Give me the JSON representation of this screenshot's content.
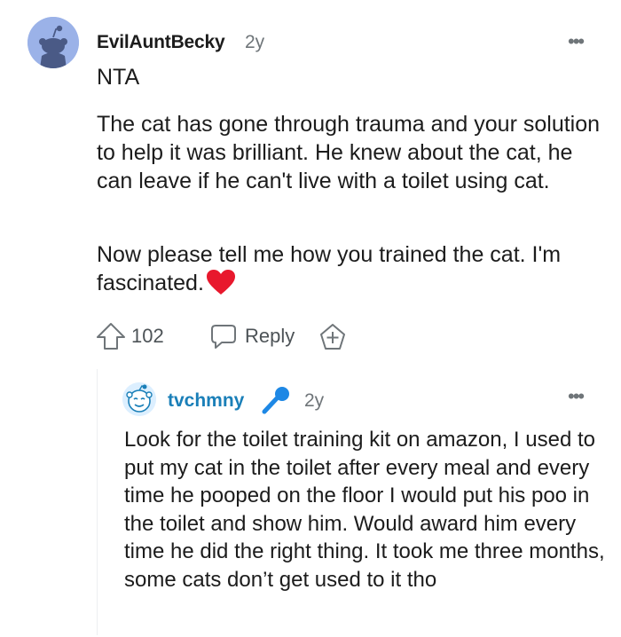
{
  "comment": {
    "username": "EvilAuntBecky",
    "age": "2y",
    "more_label": "•••",
    "paragraphs": [
      "NTA",
      "The cat has gone through trauma and your solution to help it was brilliant. He knew about the cat, he can leave if he can't live with a toilet using cat.",
      "Now please tell me how you trained the cat. I'm fascinated."
    ],
    "emoji": "heart-icon",
    "score": "102",
    "reply_label": "Reply",
    "icons": {
      "upvote": "upvote-arrow-icon",
      "reply": "speech-bubble-icon",
      "award": "award-plus-icon"
    }
  },
  "reply": {
    "username": "tvchmny",
    "flair_icon": "microphone-icon",
    "age": "2y",
    "more_label": "•••",
    "body": "Look for the toilet training kit on amazon, I used to put my cat in the toilet after every meal and every time he pooped on the floor I would put his poo in the toilet and show him. Would award him every time he did the right thing. It took me three months, some cats don’t get used to it tho"
  },
  "colors": {
    "username_reply": "#1a7fb8",
    "meta_gray": "#6f7579",
    "heart": "#e8182d",
    "avatar_bg": "#9bb2e8"
  }
}
